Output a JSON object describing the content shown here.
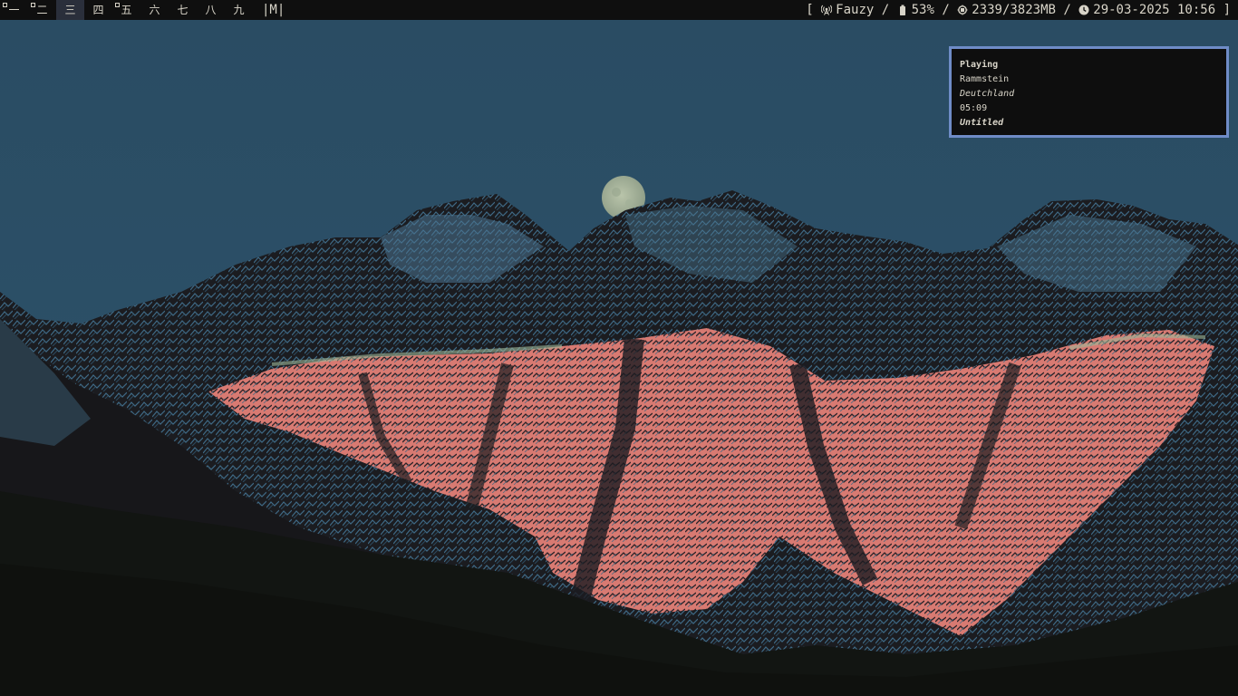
{
  "bar": {
    "tags": [
      {
        "label": "一",
        "occupied": true
      },
      {
        "label": "二",
        "occupied": true
      },
      {
        "label": "三",
        "occupied": false,
        "selected": true
      },
      {
        "label": "四",
        "occupied": false
      },
      {
        "label": "五",
        "occupied": true
      },
      {
        "label": "六",
        "occupied": false
      },
      {
        "label": "七",
        "occupied": false
      },
      {
        "label": "八",
        "occupied": false
      },
      {
        "label": "九",
        "occupied": false
      }
    ],
    "layout": "|M|",
    "status": {
      "open_bracket": "[",
      "user": "Fauzy",
      "battery": "53%",
      "memory": "2339/3823MB",
      "datetime": "29-03-2025 10:56",
      "close_bracket": "]",
      "separator": "/"
    },
    "icons": {
      "network": "antenna-icon",
      "battery": "battery-icon",
      "memory": "cpu-chip-icon",
      "clock": "clock-icon"
    }
  },
  "notification": {
    "title": "Playing",
    "artist": "Rammstein",
    "album": "Deutchland",
    "time": "05:09",
    "track": "Untitled"
  },
  "colors": {
    "bar_bg": "#0f0f0f",
    "sky": "#2b4f66",
    "notify_border": "#6f8cc7",
    "alpenglow": "#d87a72"
  }
}
